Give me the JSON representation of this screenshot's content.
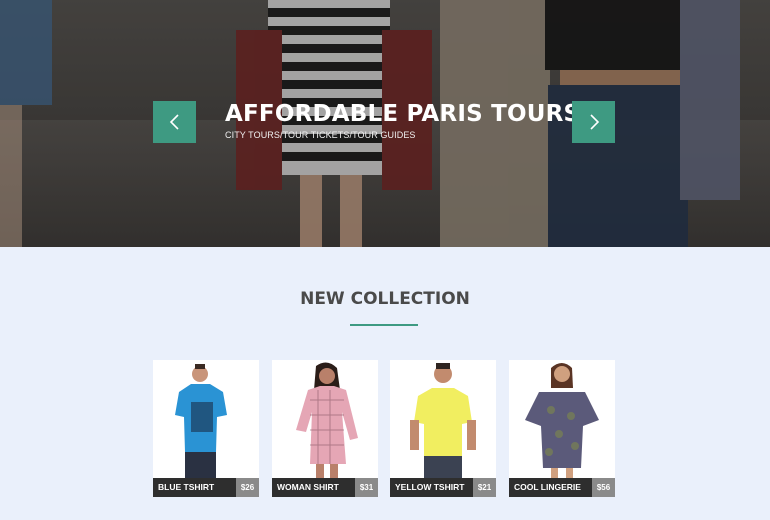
{
  "hero": {
    "title": "AFFORDABLE PARIS TOURS",
    "subtitle": "CITY TOURS/TOUR TICKETS/TOUR GUIDES",
    "prev_icon": "chevron-left-icon",
    "next_icon": "chevron-right-icon",
    "accent_color": "#3e9a82"
  },
  "collection": {
    "title": "NEW COLLECTION",
    "products": [
      {
        "name": "BLUE TSHIRT",
        "price": "$26"
      },
      {
        "name": "WOMAN SHIRT",
        "price": "$31"
      },
      {
        "name": "YELLOW TSHIRT",
        "price": "$21"
      },
      {
        "name": "COOL LINGERIE",
        "price": "$56"
      }
    ]
  }
}
